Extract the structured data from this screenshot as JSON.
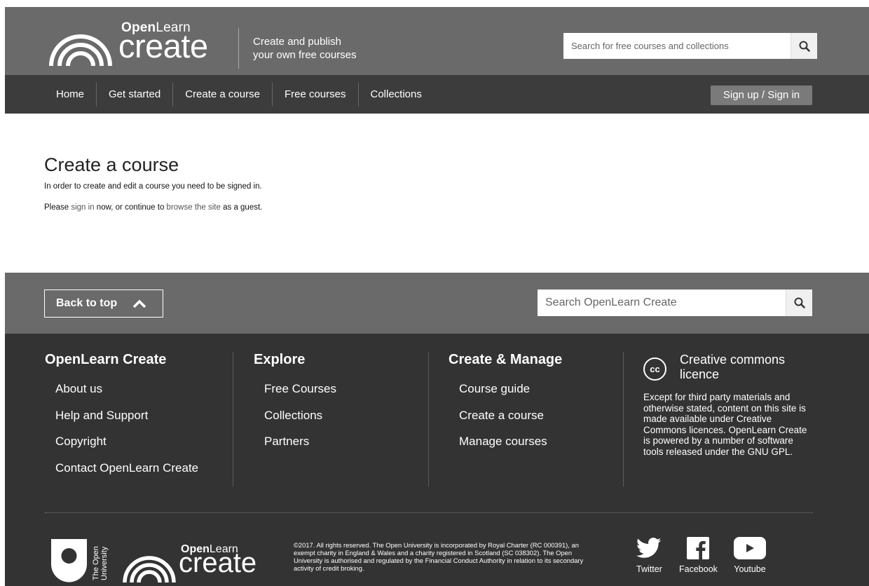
{
  "header": {
    "logo_open_bold": "Open",
    "logo_open_light": "Learn",
    "logo_create": "create",
    "tagline_line1": "Create and publish",
    "tagline_line2": "your own free courses",
    "search_placeholder": "Search for free courses and collections",
    "search_icon": "search-icon"
  },
  "nav": {
    "items": [
      "Home",
      "Get started",
      "Create a course",
      "Free courses",
      "Collections"
    ],
    "signin_label": "Sign up / Sign in"
  },
  "main": {
    "title": "Create a course",
    "line1": "In order to create and edit a course you need to be signed in.",
    "line2_prefix": "Please ",
    "line2_link1": "sign in",
    "line2_middle": " now, or continue to ",
    "line2_link2": "browse the site",
    "line2_suffix": " as a guest."
  },
  "footer": {
    "back_to_top": "Back to top",
    "search_placeholder": "Search OpenLearn Create",
    "col1": {
      "title": "OpenLearn Create",
      "links": [
        "About us",
        "Help and Support",
        "Copyright",
        "Contact OpenLearn Create"
      ]
    },
    "col2": {
      "title": "Explore",
      "links": [
        "Free Courses",
        "Collections",
        "Partners"
      ]
    },
    "col3": {
      "title": "Create & Manage",
      "links": [
        "Course guide",
        "Create a course",
        "Manage courses"
      ]
    },
    "cc": {
      "icon_text": "cc",
      "title": "Creative commons licence",
      "text": "Except for third party materials and otherwise stated, content on this site is made available under Creative Commons licences. OpenLearn Create is powered by a number of software tools released under the GNU GPL."
    },
    "ou_text_line1": "The Open",
    "ou_text_line2": "University",
    "bottom_logo_open_bold": "Open",
    "bottom_logo_open_light": "Learn",
    "bottom_logo_create": "create",
    "copyright": "©2017. All rights reserved. The Open University is incorporated by Royal Charter (RC 000391), an exempt charity in England & Wales and a charity registered in Scotland (SC 038302). The Open University is authorised and regulated by the Financial Conduct Authority in relation to its secondary activity of credit broking.",
    "social": {
      "twitter": "Twitter",
      "facebook": "Facebook",
      "youtube": "Youtube"
    }
  },
  "colors": {
    "header_bg": "#6a6a6a",
    "nav_bg": "#3c3c3c",
    "footer_bg": "#333333",
    "signin_bg": "#7a7a7a"
  }
}
